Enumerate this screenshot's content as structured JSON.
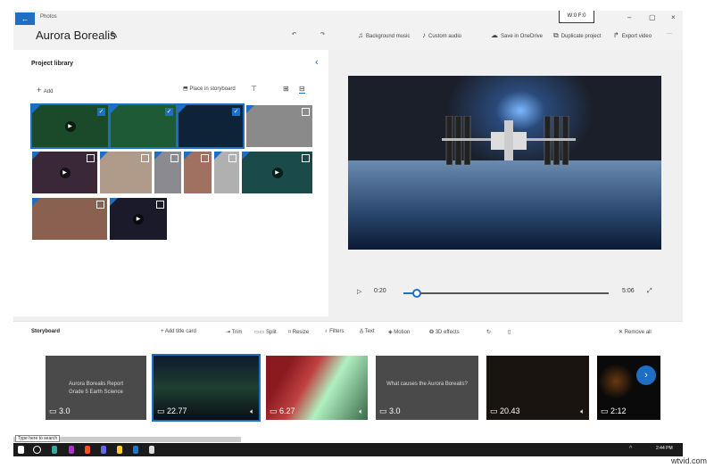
{
  "app": {
    "name": "Photos",
    "back_icon": "back-arrow-icon",
    "project_title": "Aurora Borealis",
    "wf_indicator": "W:0  F:0"
  },
  "toolbar": {
    "background_music": "Background music",
    "custom_audio": "Custom audio",
    "save_onedrive": "Save in OneDrive",
    "duplicate": "Duplicate project",
    "export": "Export video",
    "more": "···"
  },
  "window": {
    "minimize": "–",
    "maximize": "▢",
    "close": "×"
  },
  "library": {
    "title": "Project library",
    "add": "Add",
    "place": "Place in storyboard",
    "collapse": "‹",
    "items": [
      {
        "checked": true,
        "video": true,
        "color": "#1a4a2a"
      },
      {
        "checked": true,
        "video": false,
        "color": "#1d5a35"
      },
      {
        "checked": true,
        "video": false,
        "color": "#0e2238"
      },
      {
        "checked": false,
        "video": false,
        "color": "#8a8a8a"
      },
      {
        "checked": false,
        "video": true,
        "color": "#3a2838"
      },
      {
        "checked": false,
        "video": false,
        "color": "#b09a8a"
      },
      {
        "checked": false,
        "video": false,
        "color": "#8a8a90"
      },
      {
        "checked": false,
        "video": false,
        "color": "#a07060"
      },
      {
        "checked": false,
        "video": false,
        "color": "#b0b0b0"
      },
      {
        "checked": false,
        "video": true,
        "color": "#1a4a4a"
      },
      {
        "checked": false,
        "video": false,
        "color": "#8a6050"
      },
      {
        "checked": false,
        "video": true,
        "color": "#1a1a2a"
      }
    ]
  },
  "player": {
    "current": "0:20",
    "total": "5:06",
    "progress": 0.065
  },
  "storyboard": {
    "title": "Storyboard",
    "add_title_card": "Add title card",
    "trim": "Trim",
    "split": "Split",
    "resize": "Resize",
    "filters": "Filters",
    "text": "Text",
    "motion": "Motion",
    "effects": "3D effects",
    "remove_all": "Remove all",
    "cards": [
      {
        "duration": "3.0",
        "type": "title",
        "title": "Aurora Borealis Report\nGrade 5 Earth Science",
        "audio": false,
        "bg": "#4a4a4a"
      },
      {
        "duration": "22.77",
        "type": "video",
        "audio": true,
        "selected": true,
        "bg": "linear-gradient(#0e1a2e,#1e4030 50%,#0a0e18)"
      },
      {
        "duration": "6.27",
        "type": "video",
        "audio": true,
        "bg": "linear-gradient(120deg,#8a1a20 20%,#c04040 40%,#b0f0c0 60%,#3a6a4a)"
      },
      {
        "duration": "3.0",
        "type": "title",
        "title": "What causes the Aurora Borealis?",
        "audio": false,
        "bg": "#4a4a4a"
      },
      {
        "duration": "20.43",
        "type": "video",
        "audio": true,
        "bg": "#1a1410"
      },
      {
        "duration": "2:12",
        "type": "video",
        "audio": false,
        "bg": "radial-gradient(circle at 30% 40%,#6a3a10 0,#0a0a0a 30%)"
      }
    ]
  },
  "taskbar": {
    "search": "Type here to search",
    "time": "2:44 PM"
  },
  "watermark": "wtvid.com"
}
